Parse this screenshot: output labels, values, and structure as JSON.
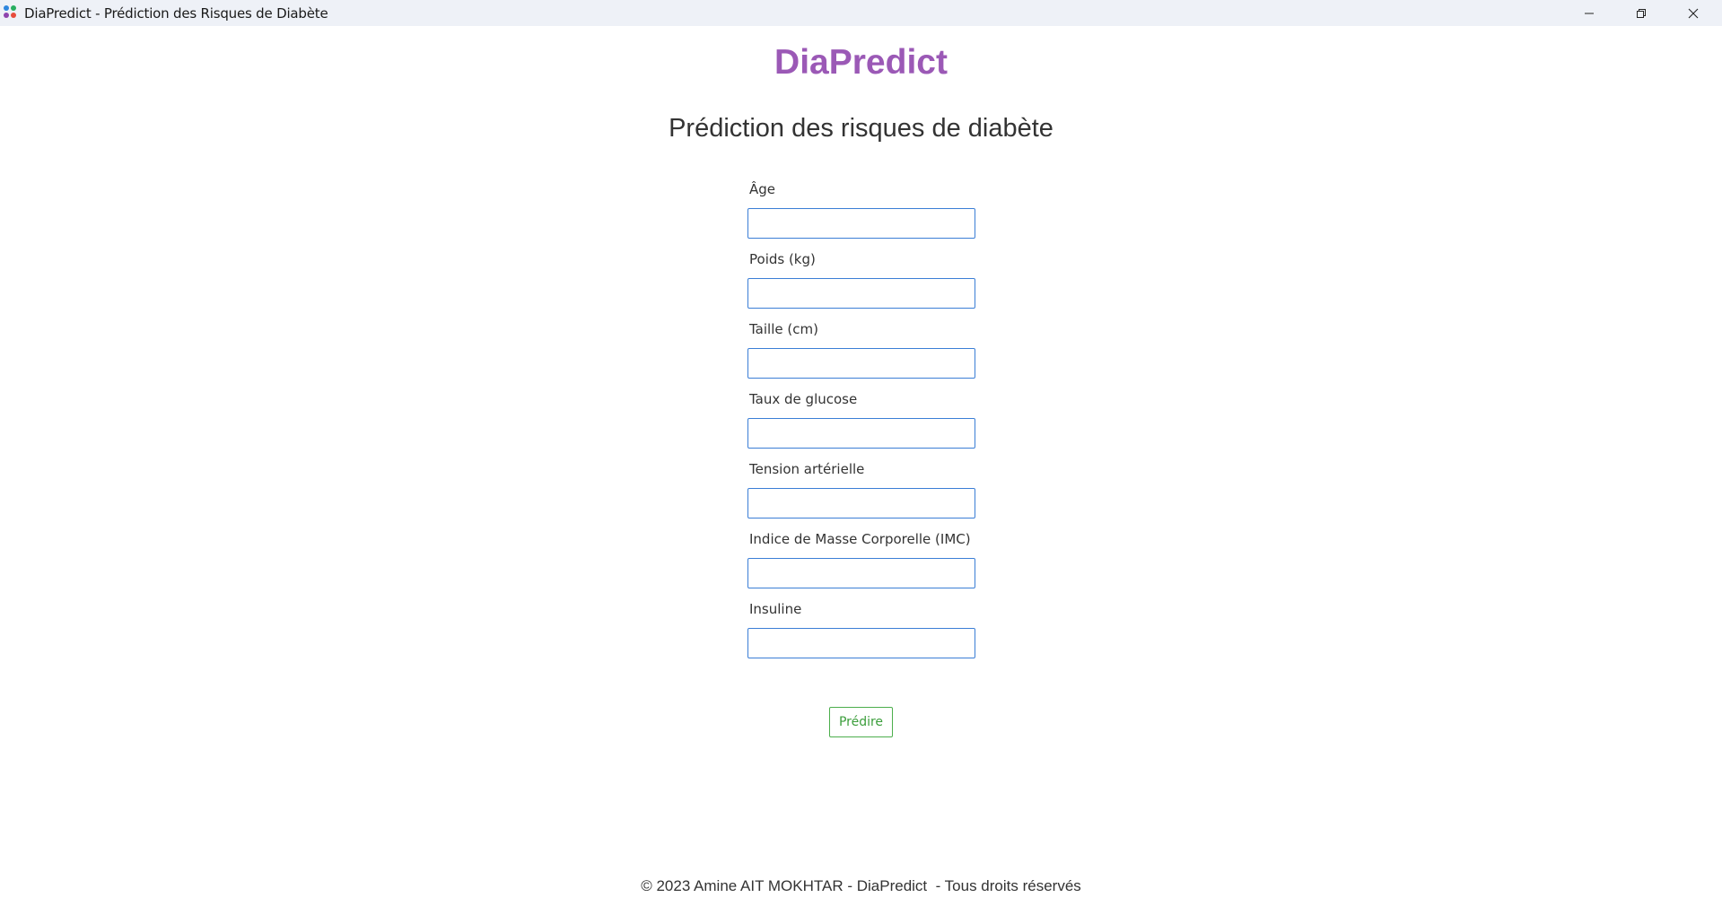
{
  "window": {
    "title": "DiaPredict - Prédiction des Risques de Diabète",
    "controls": [
      "minimize",
      "restore",
      "close"
    ]
  },
  "header": {
    "brand": "DiaPredict",
    "subtitle": "Prédiction des risques de diabète",
    "brand_color": "#9b59b6"
  },
  "form": {
    "fields": [
      {
        "label": "Âge",
        "value": ""
      },
      {
        "label": "Poids (kg)",
        "value": ""
      },
      {
        "label": "Taille (cm)",
        "value": ""
      },
      {
        "label": "Taux de glucose",
        "value": ""
      },
      {
        "label": "Tension artérielle",
        "value": ""
      },
      {
        "label": "Indice de Masse Corporelle (IMC)",
        "value": ""
      },
      {
        "label": "Insuline",
        "value": ""
      }
    ],
    "submit_label": "Prédire",
    "input_border_color": "#3b7ed6",
    "submit_color": "#4cae4c"
  },
  "footer": {
    "text": "© 2023 Amine AIT MOKHTAR - DiaPredict  - Tous droits réservés"
  }
}
